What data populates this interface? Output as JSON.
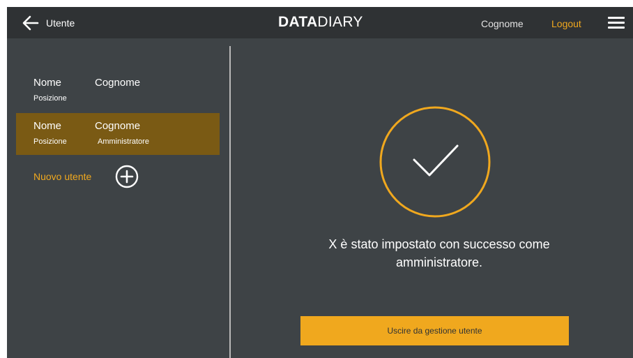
{
  "header": {
    "back_label": "Utente",
    "logo_bold": "DATA",
    "logo_light": "DIARY",
    "user_name": "Cognome",
    "logout_label": "Logout"
  },
  "sidebar": {
    "users": [
      {
        "first_name": "Nome",
        "last_name": "Cognome",
        "position": "Posizione",
        "role": "",
        "selected": false
      },
      {
        "first_name": "Nome",
        "last_name": "Cognome",
        "position": "Posizione",
        "role": "Amministratore",
        "selected": true
      }
    ],
    "new_user_label": "Nuovo utente"
  },
  "main": {
    "message": "X è stato impostato con successo come amministratore.",
    "exit_button_label": "Uscire da gestione utente"
  },
  "colors": {
    "accent": "#f0a81e",
    "selected_row": "#7a5a14",
    "background": "#3e4346",
    "topbar": "#2f3234"
  }
}
